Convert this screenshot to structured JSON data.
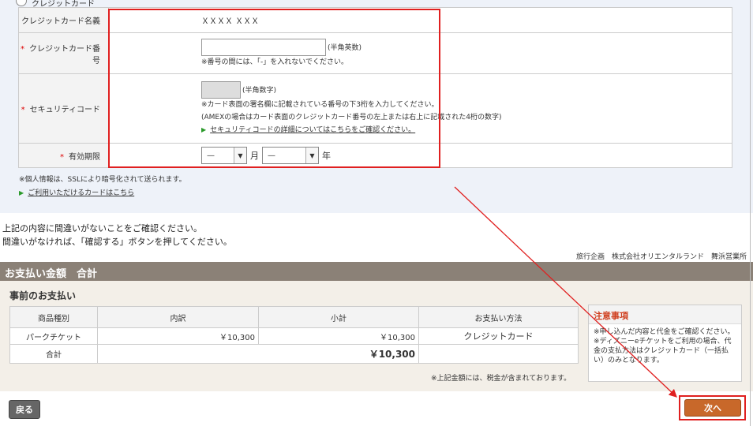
{
  "card_form": {
    "radio_label": "クレジットカード",
    "rows": {
      "name_label": "クレジットカード名義",
      "name_value": "ＸＸＸＸ ＸＸＸ",
      "number_label": "クレジットカード番号",
      "number_value": "",
      "number_hint": "(半角英数)",
      "number_note": "※番号の間には、「-」を入れないでください。",
      "security_label": "セキュリティコード",
      "security_value": "",
      "security_hint": "(半角数字)",
      "security_note1": "※カード表面の署名欄に記載されている番号の下3桁を入力してください。",
      "security_note2": "(AMEXの場合はカード表面のクレジットカード番号の左上または右上に記載された4桁の数字)",
      "security_link": "セキュリティコードの詳細についてはこちらをご確認ください。",
      "expiry_label": "有効期限",
      "month_value": "—",
      "month_unit": "月",
      "year_value": "—",
      "year_unit": "年",
      "required_mark": "*"
    },
    "ssl_note": "※個人情報は、SSLにより暗号化されて送られます。",
    "cards_link": "ご利用いただけるカードはこちら"
  },
  "confirm": {
    "line1": "上記の内容に間違いがないことをご確認ください。",
    "line2": "間違いがなければ、「確認する」ボタンを押してください。",
    "company": "旅行企画　株式会社オリエンタルランド　舞浜営業所"
  },
  "payment": {
    "header": "お支払い金額　合計",
    "pre_title": "事前のお支払い",
    "columns": [
      "商品種別",
      "内訳",
      "小計",
      "お支払い方法"
    ],
    "row": {
      "type": "パークチケット",
      "detail": "￥10,300",
      "subtotal": "￥10,300",
      "method": "クレジットカード"
    },
    "total_label": "合計",
    "total_value": "￥10,300",
    "tax_note": "※上記金額には、税金が含まれております。"
  },
  "notice": {
    "title": "注意事項",
    "text1": "※申し込んだ内容と代金をご確認ください。",
    "text2": "※ディズニーeチケットをご利用の場合、代金の支払方法はクレジットカード（一括払い）のみとなります。"
  },
  "buttons": {
    "back": "戻る",
    "next": "次へ"
  },
  "colors": {
    "highlight": "#e02020",
    "header_bg": "#8b8177",
    "next_bg": "#c8682a",
    "required": "#dd0000"
  }
}
